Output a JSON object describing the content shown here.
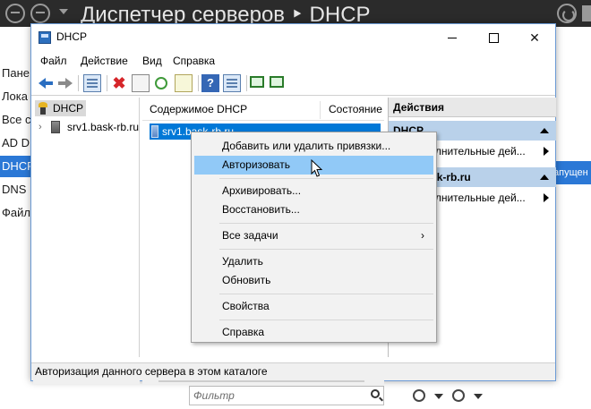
{
  "server_manager": {
    "title": "Диспетчер серверов ‣ DHCP",
    "nav_items": [
      {
        "label": "Пане",
        "selected": false
      },
      {
        "label": "Лока",
        "selected": false
      },
      {
        "label": "Все с",
        "selected": false
      },
      {
        "label": "AD D",
        "selected": false
      },
      {
        "label": "DHCP",
        "selected": true
      },
      {
        "label": "DNS",
        "selected": false
      },
      {
        "label": "Файл",
        "selected": false
      }
    ],
    "right_badge": "апущен",
    "filter_placeholder": "Фильтр"
  },
  "window": {
    "title": "DHCP",
    "min_icon": "minimize-icon",
    "max_icon": "maximize-icon",
    "close_label": "✕",
    "menu": [
      "Файл",
      "Действие",
      "Вид",
      "Справка"
    ]
  },
  "tree": {
    "root": "DHCP",
    "child": "srv1.bask-rb.ru",
    "expand": "›"
  },
  "center": {
    "col_content": "Содержимое DHCP",
    "col_status": "Состояние",
    "row": "srv1.bask-rb.ru"
  },
  "actions": {
    "header": "Действия",
    "section1": "DHCP",
    "item1": "Дополнительные дей...",
    "section2": "srv1.bask-rb.ru",
    "item2": "Дополнительные дей..."
  },
  "status": "Авторизация данного сервера в этом каталоге",
  "context_menu": {
    "items": [
      "Добавить или удалить привязки...",
      "Авторизовать",
      "Архивировать...",
      "Восстановить...",
      "Все задачи",
      "Удалить",
      "Обновить",
      "Свойства",
      "Справка"
    ],
    "submenu_arrow": "›",
    "highlighted": "Авторизовать"
  },
  "colors": {
    "selection": "#0078d7",
    "menu_highlight": "#91c9f7",
    "actions_section": "#b9d1ea",
    "sm_titlebar": "#2b2b2b"
  }
}
